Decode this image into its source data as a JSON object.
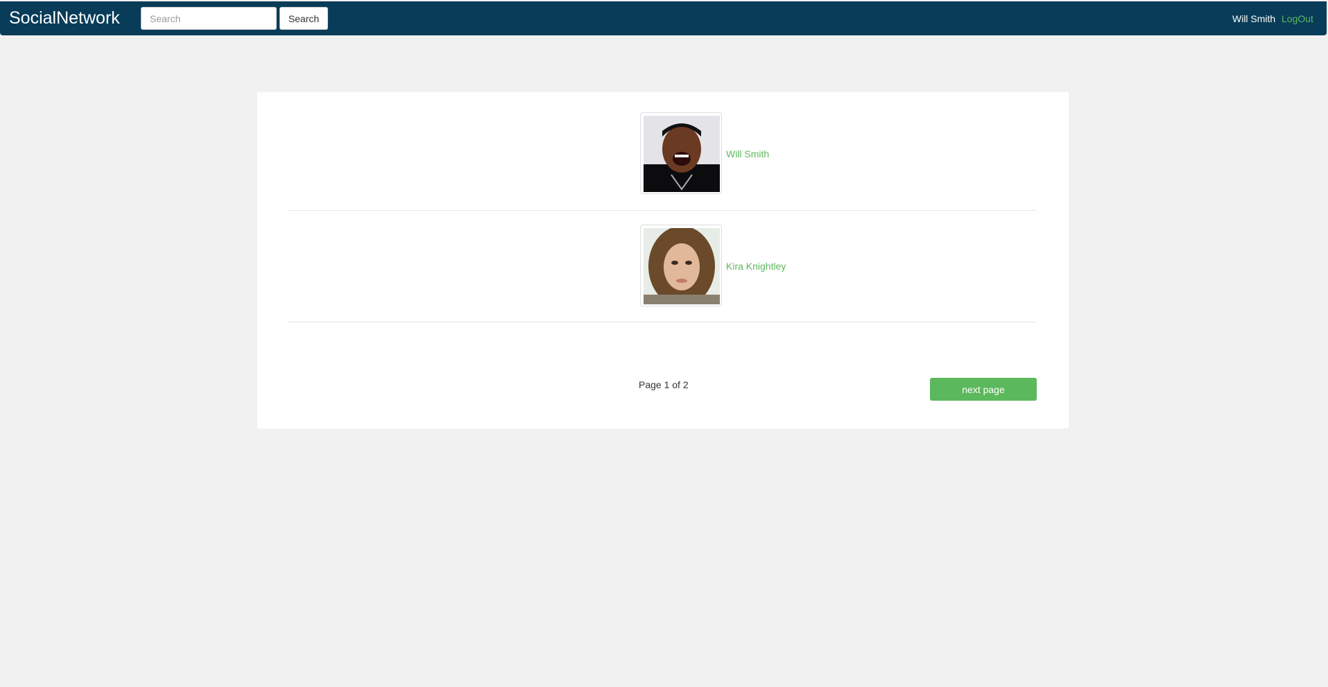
{
  "navbar": {
    "brand": "SocialNetwork",
    "search_placeholder": "Search",
    "search_button": "Search",
    "user_name": "Will Smith",
    "logout": "LogOut"
  },
  "users": [
    {
      "name": "Will Smith"
    },
    {
      "name": "Kira Knightley"
    }
  ],
  "pagination": {
    "page_info": "Page 1 of 2",
    "next_label": "next page"
  },
  "colors": {
    "navbar": "#083c58",
    "accent": "#5cb85c"
  }
}
